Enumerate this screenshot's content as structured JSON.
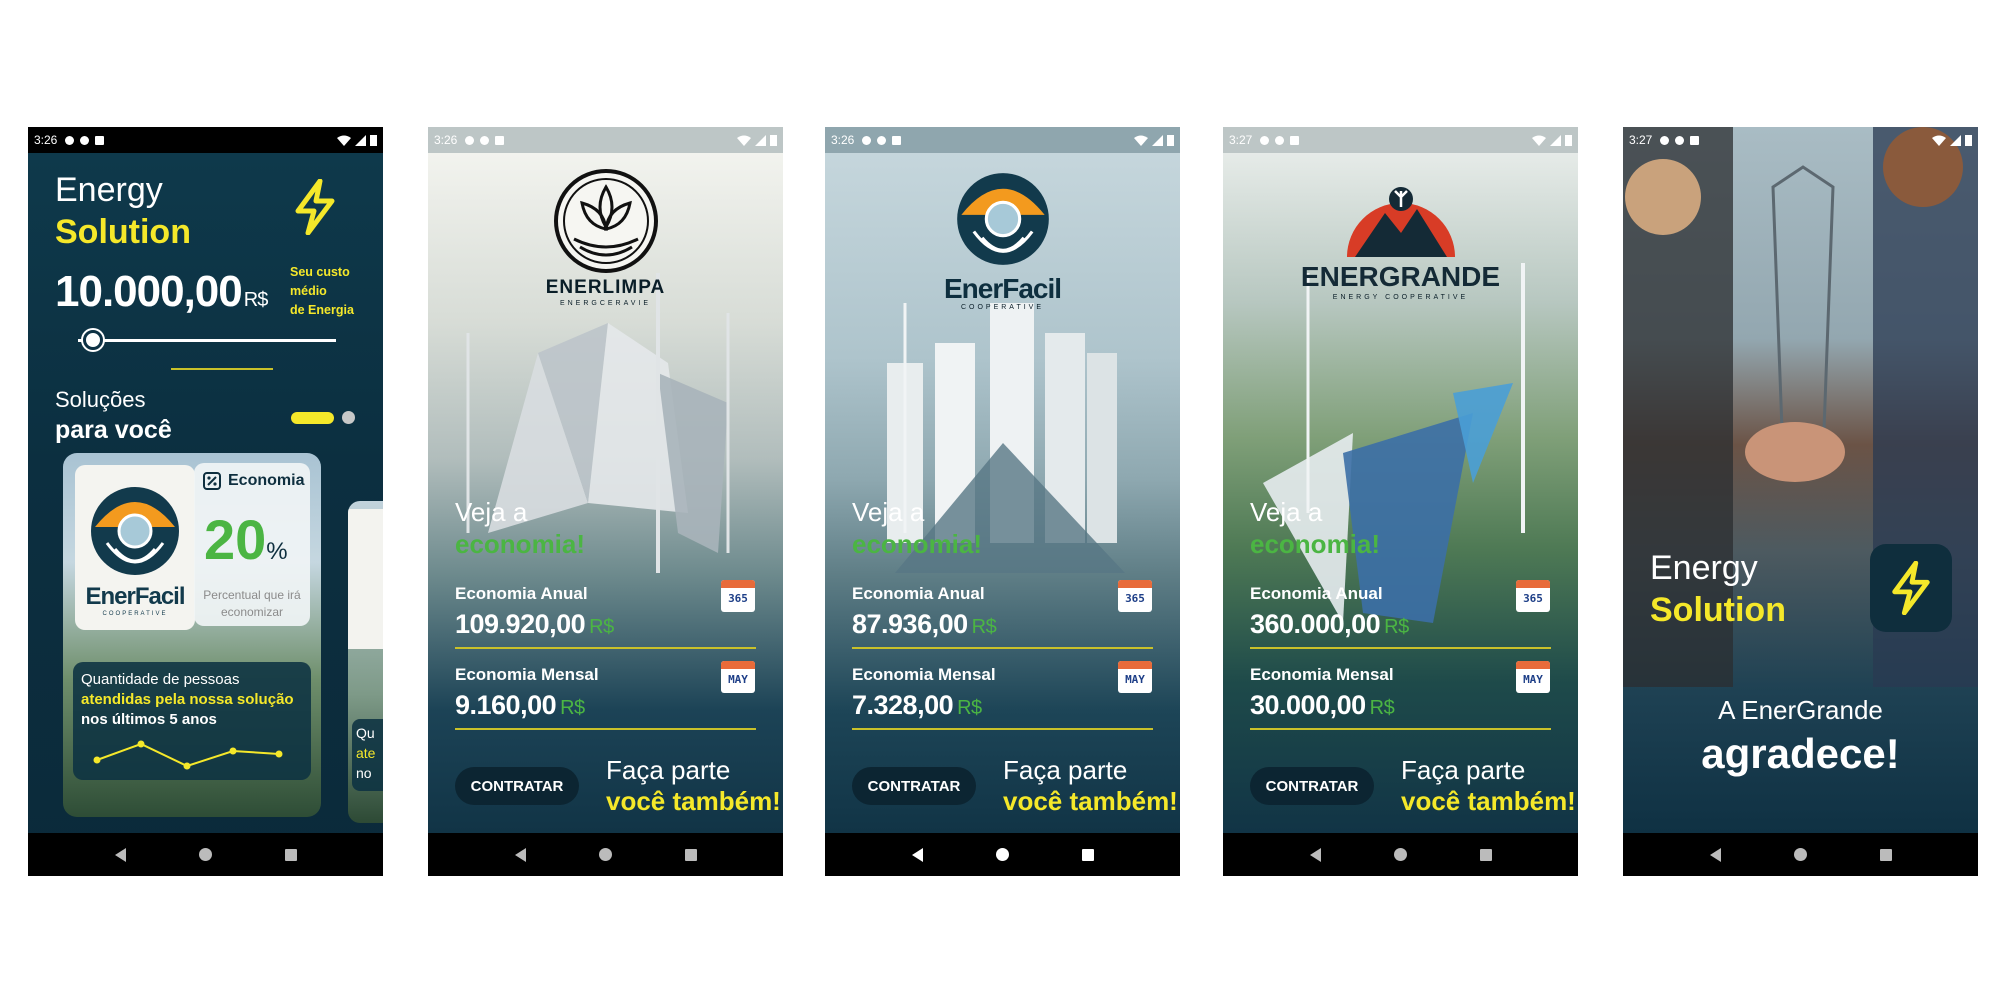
{
  "screens": [
    {
      "status_time": "3:26",
      "app_title": {
        "line1": "Energy",
        "line2": "Solution"
      },
      "price": {
        "value": "10.000,00",
        "currency": "R$"
      },
      "price_caption": [
        "Seu custo",
        "médio",
        "de Energia"
      ],
      "slider_value_fraction": 0.06,
      "section": {
        "line1": "Soluções",
        "line2": "para você"
      },
      "card": {
        "brand": "EnerFacil",
        "brand_sub": "COOPERATIVE",
        "economy_label": "Economia",
        "economy_value": "20",
        "economy_unit": "%",
        "economy_caption": [
          "Percentual que irá",
          "economizar"
        ],
        "people_text": {
          "line1": "Quantidade de pessoas",
          "line2": "atendidas pela nossa solução",
          "line3": "nos últimos 5 anos"
        }
      },
      "card2_text": [
        "Qu",
        "ate",
        "no"
      ]
    },
    {
      "status_time": "3:26",
      "brand": "ENERLIMPA",
      "brand_sub": "ENERGCERAVIE",
      "intro": {
        "line1": "Veja a",
        "line2": "economia!"
      },
      "annual": {
        "label": "Economia Anual",
        "value": "109.920,00",
        "currency": "R$",
        "icon": "365"
      },
      "monthly": {
        "label": "Economia Mensal",
        "value": "9.160,00",
        "currency": "R$",
        "icon": "MAY"
      },
      "button": "CONTRATAR",
      "cta": {
        "line1": "Faça parte",
        "line2": "você também!"
      }
    },
    {
      "status_time": "3:26",
      "brand": "EnerFacil",
      "brand_sub": "COOPERATIVE",
      "intro": {
        "line1": "Veja a",
        "line2": "economia!"
      },
      "annual": {
        "label": "Economia Anual",
        "value": "87.936,00",
        "currency": "R$",
        "icon": "365"
      },
      "monthly": {
        "label": "Economia Mensal",
        "value": "7.328,00",
        "currency": "R$",
        "icon": "MAY"
      },
      "button": "CONTRATAR",
      "cta": {
        "line1": "Faça parte",
        "line2": "você também!"
      }
    },
    {
      "status_time": "3:27",
      "brand": "ENERGRANDE",
      "brand_sub": "ENERGY COOPERATIVE",
      "intro": {
        "line1": "Veja a",
        "line2": "economia!"
      },
      "annual": {
        "label": "Economia Anual",
        "value": "360.000,00",
        "currency": "R$",
        "icon": "365"
      },
      "monthly": {
        "label": "Economia Mensal",
        "value": "30.000,00",
        "currency": "R$",
        "icon": "MAY"
      },
      "button": "CONTRATAR",
      "cta": {
        "line1": "Faça parte",
        "line2": "você também!"
      }
    },
    {
      "status_time": "3:27",
      "app_title": {
        "line1": "Energy",
        "line2": "Solution"
      },
      "thanks": {
        "line1": "A EnerGrande",
        "line2": "agradece!"
      }
    }
  ],
  "colors": {
    "accent_yellow": "#f5e82a",
    "accent_green": "#4bb543",
    "dark_navy": "#0d3144"
  },
  "icons": [
    "bolt-icon",
    "gear-icon",
    "shield-icon",
    "sd-card-icon",
    "wifi-icon",
    "signal-icon",
    "battery-icon",
    "calendar-icon",
    "discount-icon"
  ]
}
